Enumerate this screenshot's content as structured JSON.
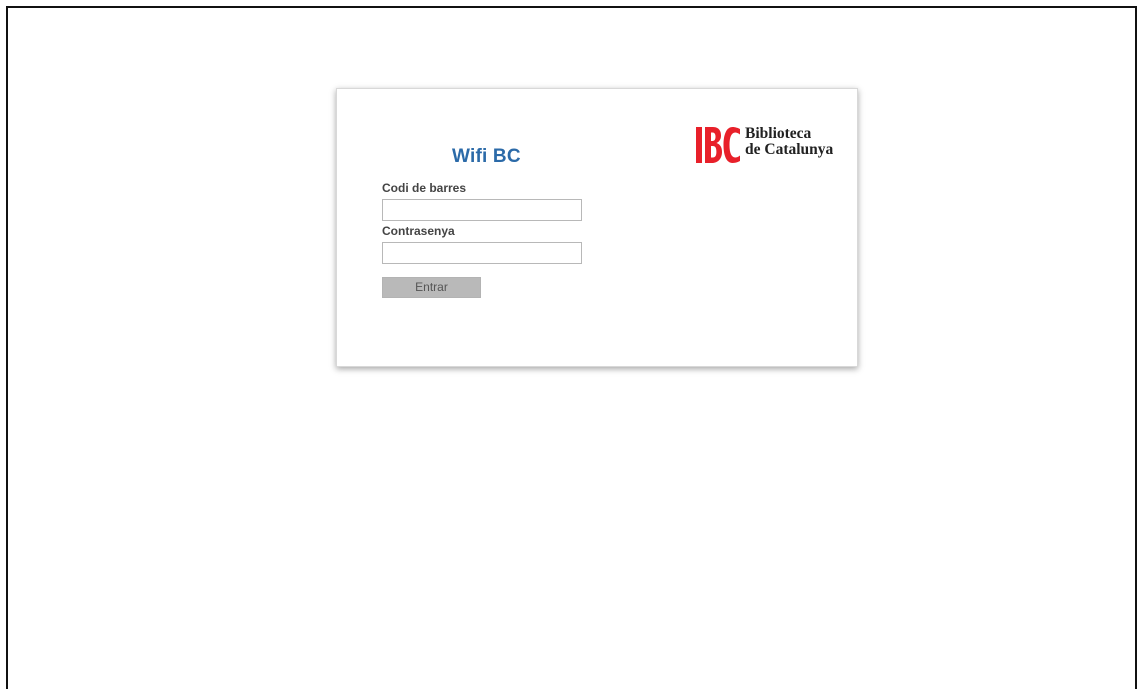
{
  "form": {
    "title": "Wifi BC",
    "barcode_label": "Codi de barres",
    "barcode_value": "",
    "password_label": "Contrasenya",
    "password_value": "",
    "submit_label": "Entrar"
  },
  "logo": {
    "mark": "BC",
    "line1": "Biblioteca",
    "line2": "de Catalunya",
    "brand_color": "#e8202a"
  },
  "colors": {
    "title": "#2b6aa8",
    "button_bg": "#b9b9b9"
  }
}
